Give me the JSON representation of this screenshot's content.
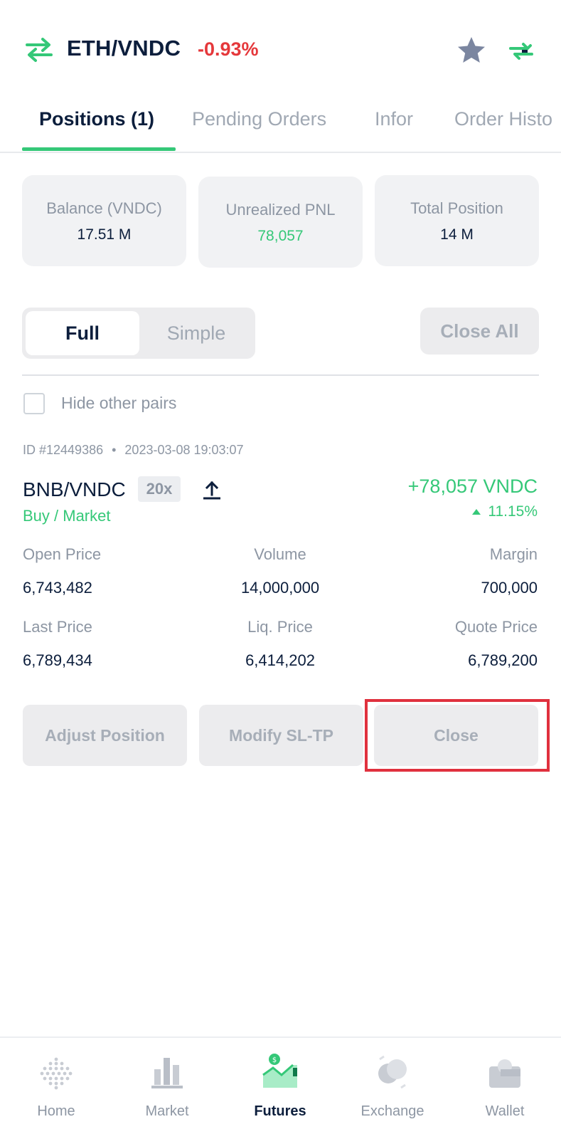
{
  "header": {
    "pair": "ETH/VNDC",
    "change": "-0.93%",
    "change_color": "#e5383b",
    "icons": [
      "swap-arrows-icon",
      "star-icon",
      "exchange-arrows-icon"
    ]
  },
  "tabs": [
    {
      "label": "Positions (1)",
      "active": true
    },
    {
      "label": "Pending Orders",
      "active": false
    },
    {
      "label": "Infor",
      "active": false
    },
    {
      "label": "Order Histo",
      "active": false
    }
  ],
  "summary": [
    {
      "label": "Balance (VNDC)",
      "value": "17.51 M"
    },
    {
      "label": "Unrealized PNL",
      "value": "78,057"
    },
    {
      "label": "Total Position",
      "value": "14 M"
    }
  ],
  "view_toggle": {
    "full": "Full",
    "simple": "Simple",
    "selected": "Full"
  },
  "close_all": "Close All",
  "hide_other_pairs": {
    "label": "Hide other pairs",
    "checked": false
  },
  "position": {
    "id": "ID #12449386",
    "dot": "•",
    "datetime": "2023-03-08 19:03:07",
    "pair": "BNB/VNDC",
    "leverage": "20x",
    "side": "Buy / Market",
    "pnl": "+78,057 VNDC",
    "pnl_pct": "11.15%",
    "stats": {
      "open_price": {
        "label": "Open Price",
        "value": "6,743,482"
      },
      "volume": {
        "label": "Volume",
        "value": "14,000,000"
      },
      "margin": {
        "label": "Margin",
        "value": "700,000"
      },
      "last_price": {
        "label": "Last Price",
        "value": "6,789,434"
      },
      "liq_price": {
        "label": "Liq. Price",
        "value": "6,414,202"
      },
      "quote_price": {
        "label": "Quote Price",
        "value": "6,789,200"
      }
    },
    "actions": {
      "adjust": "Adjust Position",
      "modify": "Modify SL-TP",
      "close": "Close"
    }
  },
  "nav": [
    {
      "label": "Home",
      "icon": "home-dots-icon",
      "active": false
    },
    {
      "label": "Market",
      "icon": "market-bars-icon",
      "active": false
    },
    {
      "label": "Futures",
      "icon": "futures-chart-icon",
      "active": true
    },
    {
      "label": "Exchange",
      "icon": "exchange-coins-icon",
      "active": false
    },
    {
      "label": "Wallet",
      "icon": "wallet-icon",
      "active": false
    }
  ],
  "colors": {
    "accent_green": "#35c878",
    "negative_red": "#e5383b",
    "highlight_red": "#e0313e",
    "text_dark": "#0c1e3c",
    "text_muted": "#8d96a3"
  }
}
